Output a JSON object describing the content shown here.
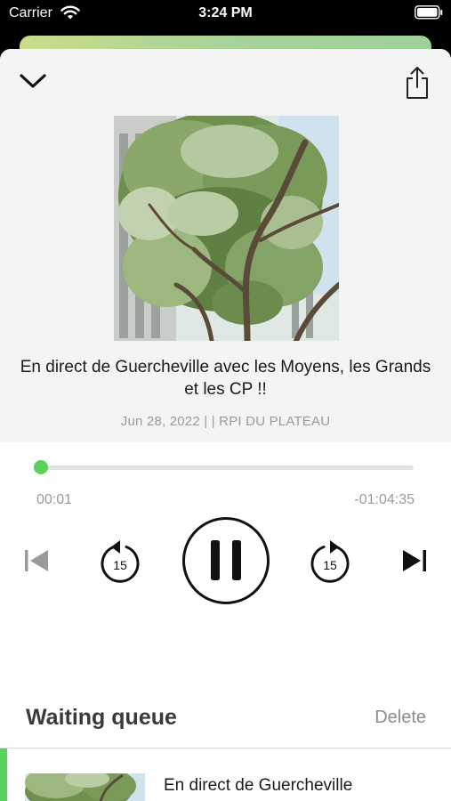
{
  "status_bar": {
    "carrier": "Carrier",
    "time": "3:24 PM"
  },
  "player": {
    "episode_title": "En direct de Guercheville avec les Moyens, les Grands et les CP !!",
    "meta": "Jun 28, 2022 |  | RPI DU PLATEAU",
    "elapsed": "00:01",
    "remaining": "-01:04:35",
    "progress_fraction": 0.001,
    "skip_back_seconds": "15",
    "skip_forward_seconds": "15",
    "state": "playing"
  },
  "queue": {
    "title": "Waiting queue",
    "delete_label": "Delete",
    "items": [
      {
        "title": "En direct de Guercheville"
      }
    ]
  },
  "colors": {
    "accent": "#5bd05b",
    "peek_gradient_start": "#cbdc8a",
    "peek_gradient_end": "#9fcf9a"
  },
  "icons": {
    "collapse": "chevron-down-icon",
    "share": "share-icon",
    "previous": "skip-previous-icon",
    "rewind": "rewind-15-icon",
    "play_pause": "pause-icon",
    "forward": "forward-15-icon",
    "next": "skip-next-icon"
  }
}
